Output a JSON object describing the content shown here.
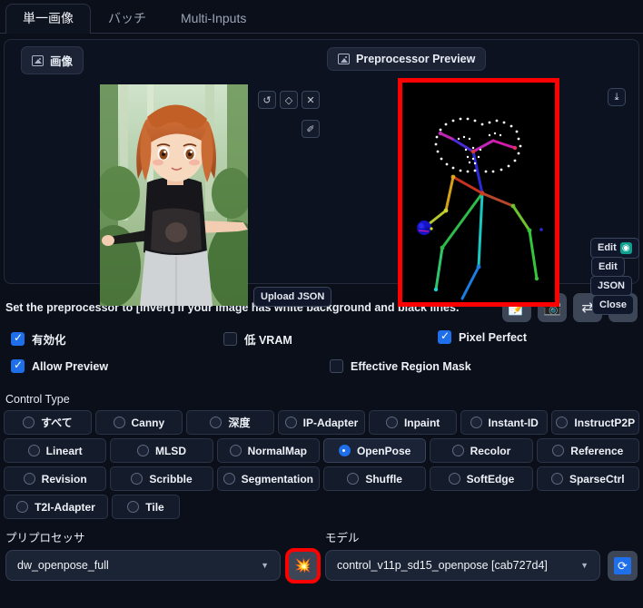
{
  "tabs": [
    {
      "label": "単一画像",
      "active": true
    },
    {
      "label": "バッチ",
      "active": false
    },
    {
      "label": "Multi-Inputs",
      "active": false
    }
  ],
  "panel": {
    "image_tab": "画像",
    "preprocessor_tab": "Preprocessor Preview",
    "tools": [
      {
        "name": "undo-icon",
        "glyph": "↺"
      },
      {
        "name": "eraser-icon",
        "glyph": "◇"
      },
      {
        "name": "clear-icon",
        "glyph": "✕"
      },
      {
        "name": "pen-icon",
        "glyph": "✐"
      }
    ],
    "upload_json": "Upload JSON",
    "download_glyph": "⤓",
    "side_buttons": [
      {
        "label": "Edit",
        "badge": "◉"
      },
      {
        "label": "Edit",
        "badge": ""
      },
      {
        "label": "JSON",
        "badge": ""
      },
      {
        "label": "Close",
        "badge": ""
      }
    ]
  },
  "hint": {
    "text": "Set the preprocessor to [invert] If your image has white background and black lines.",
    "icons": [
      {
        "name": "note-edit-icon",
        "glyph": "📝"
      },
      {
        "name": "camera-icon",
        "glyph": "📷"
      },
      {
        "name": "swap-icon",
        "glyph": "⇄"
      },
      {
        "name": "curve-arrow-icon",
        "glyph": "↗"
      }
    ]
  },
  "checkboxes": [
    {
      "label": "有効化",
      "checked": true
    },
    {
      "label": "低 VRAM",
      "checked": false
    },
    {
      "label": "Pixel Perfect",
      "checked": true
    },
    {
      "label": "Allow Preview",
      "checked": true
    },
    {
      "label": "Effective Region Mask",
      "checked": false
    }
  ],
  "control_type": {
    "label": "Control Type",
    "selected": "OpenPose",
    "rows": [
      [
        "すべて",
        "Canny",
        "深度",
        "IP-Adapter",
        "Inpaint",
        "Instant-ID",
        "InstructP2P"
      ],
      [
        "Lineart",
        "MLSD",
        "NormalMap",
        "OpenPose",
        "Recolor",
        "Reference"
      ],
      [
        "Revision",
        "Scribble",
        "Segmentation",
        "Shuffle",
        "SoftEdge",
        "SparseCtrl"
      ],
      [
        "T2I-Adapter",
        "Tile"
      ]
    ]
  },
  "preprocessor": {
    "label": "プリプロセッサ",
    "value": "dw_openpose_full",
    "run_icon": "💥"
  },
  "model": {
    "label": "モデル",
    "value": "control_v11p_sd15_openpose [cab727d4]",
    "refresh_icon": "⟳"
  },
  "colors": {
    "accent": "#1f6feb",
    "highlight": "#ff0000",
    "panel": "#0d1220",
    "background": "#0b0f19"
  }
}
